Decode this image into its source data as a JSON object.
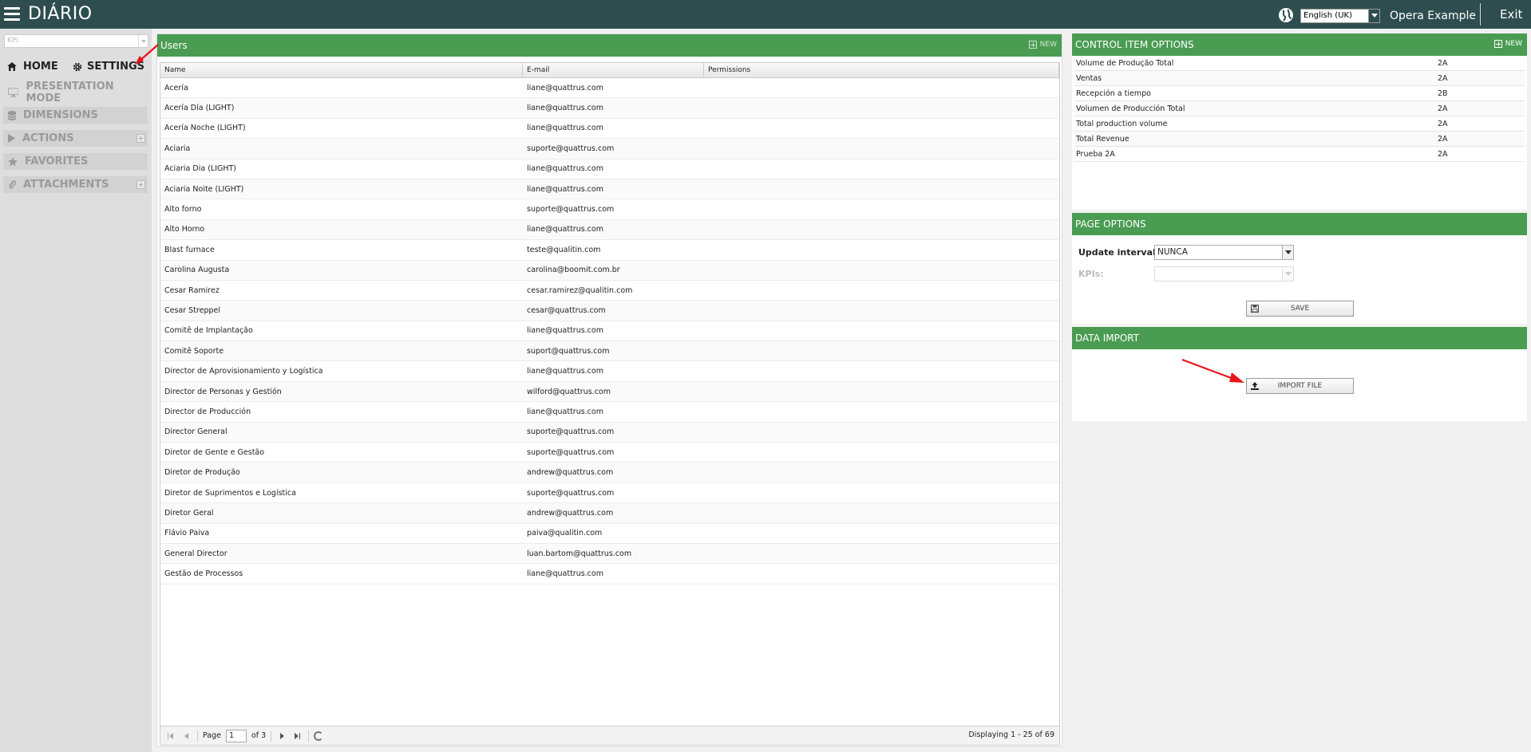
{
  "app": {
    "title": "DIÁRIO",
    "language": "English (UK)",
    "user": "Opera Example",
    "exit_label": "Exit"
  },
  "sidebar": {
    "kpi_placeholder": "KPI",
    "home_label": "HOME",
    "settings_label": "SETTINGS",
    "presentation_label": "PRESENTATION MODE",
    "dimensions_label": "DIMENSIONS",
    "actions_label": "ACTIONS",
    "favorites_label": "FAVORITES",
    "attachments_label": "ATTACHMENTS"
  },
  "users": {
    "title": "Users",
    "new_label": "NEW",
    "columns": [
      "Name",
      "E-mail",
      "Permissions"
    ],
    "rows": [
      [
        "Acería",
        "liane@quattrus.com"
      ],
      [
        "Acería Día (LIGHT)",
        "liane@quattrus.com"
      ],
      [
        "Acería Noche (LIGHT)",
        "liane@quattrus.com"
      ],
      [
        "Aciaria",
        "suporte@quattrus.com"
      ],
      [
        "Aciaria Dia (LIGHT)",
        "liane@quattrus.com"
      ],
      [
        "Aciaria Noite (LIGHT)",
        "liane@quattrus.com"
      ],
      [
        "Alto forno",
        "suporte@quattrus.com"
      ],
      [
        "Alto Horno",
        "liane@quattrus.com"
      ],
      [
        "Blast furnace",
        "teste@qualitin.com"
      ],
      [
        "Carolina Augusta",
        "carolina@boomit.com.br"
      ],
      [
        "Cesar Ramirez",
        "cesar.ramirez@qualitin.com"
      ],
      [
        "Cesar Streppel",
        "cesar@quattrus.com"
      ],
      [
        "Comitê de Implantação",
        "liane@quattrus.com"
      ],
      [
        "Comitê Soporte",
        "suport@quattrus.com"
      ],
      [
        "Director de Aprovisionamiento y Logística",
        "liane@quattrus.com"
      ],
      [
        "Director de Personas y Gestión",
        "wilford@quattrus.com"
      ],
      [
        "Director de Producción",
        "liane@quattrus.com"
      ],
      [
        "Director General",
        "suporte@quattrus.com"
      ],
      [
        "Diretor de Gente e Gestão",
        "suporte@quattrus.com"
      ],
      [
        "Diretor de Produção",
        "andrew@quattrus.com"
      ],
      [
        "Diretor de Suprimentos e Logística",
        "suporte@quattrus.com"
      ],
      [
        "Diretor Geral",
        "andrew@quattrus.com"
      ],
      [
        "Flávio Paiva",
        "paiva@qualitin.com"
      ],
      [
        "General Director",
        "luan.bartom@quattrus.com"
      ],
      [
        "Gestão de Processos",
        "liane@quattrus.com"
      ]
    ],
    "pager": {
      "page_label": "Page",
      "page_value": "1",
      "of_label": "of 3",
      "info": "Displaying 1 - 25 of 69"
    }
  },
  "control_items": {
    "title": "CONTROL ITEM OPTIONS",
    "new_label": "NEW",
    "rows": [
      [
        "Volume de Produção Total",
        "2A"
      ],
      [
        "Ventas",
        "2A"
      ],
      [
        "Recepción a tiempo",
        "2B"
      ],
      [
        "Volumen de Producción Total",
        "2A"
      ],
      [
        "Total production volume",
        "2A"
      ],
      [
        "Total Revenue",
        "2A"
      ],
      [
        "Prueba 2A",
        "2A"
      ]
    ]
  },
  "page_options": {
    "title": "PAGE OPTIONS",
    "update_label": "Update interval:",
    "update_value": "NUNCA",
    "kpis_label": "KPIs:",
    "save_label": "SAVE"
  },
  "data_import": {
    "title": "DATA IMPORT",
    "import_label": "IMPORT FILE"
  },
  "colors": {
    "topbar": "#2e4d4e",
    "header_green": "#4a9c52",
    "annotation_red": "#e8141a"
  }
}
